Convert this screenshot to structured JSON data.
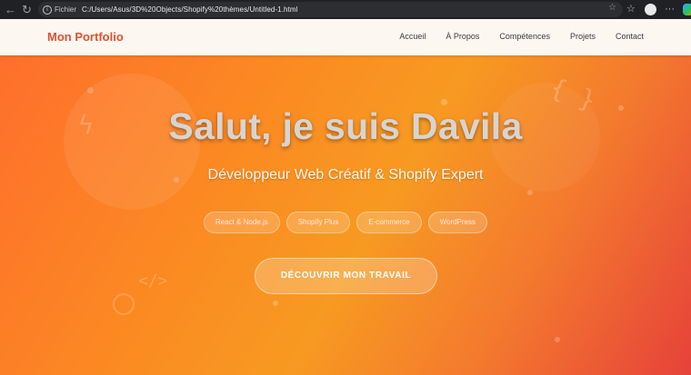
{
  "browser": {
    "scheme_label": "Fichier",
    "url": "C:/Users/Asus/3D%20Objects/Shopify%20thèmes/Untitled-1.html"
  },
  "header": {
    "logo": "Mon Portfolio",
    "nav": [
      "Accueil",
      "À Propos",
      "Compétences",
      "Projets",
      "Contact"
    ]
  },
  "hero": {
    "title": "Salut, je suis Davila",
    "subtitle": "Développeur Web Créatif & Shopify Expert",
    "chips": [
      "React & Node.js",
      "Shopify Plus",
      "E-commerce",
      "WordPress"
    ],
    "cta": "DÉCOUVRIR MON TRAVAIL"
  },
  "decorations": {
    "code_tag": "</>",
    "braces": "{ }"
  },
  "colors": {
    "accent": "#e0512b",
    "gradient_start": "#ff6d2d",
    "gradient_end": "#e6423a"
  }
}
